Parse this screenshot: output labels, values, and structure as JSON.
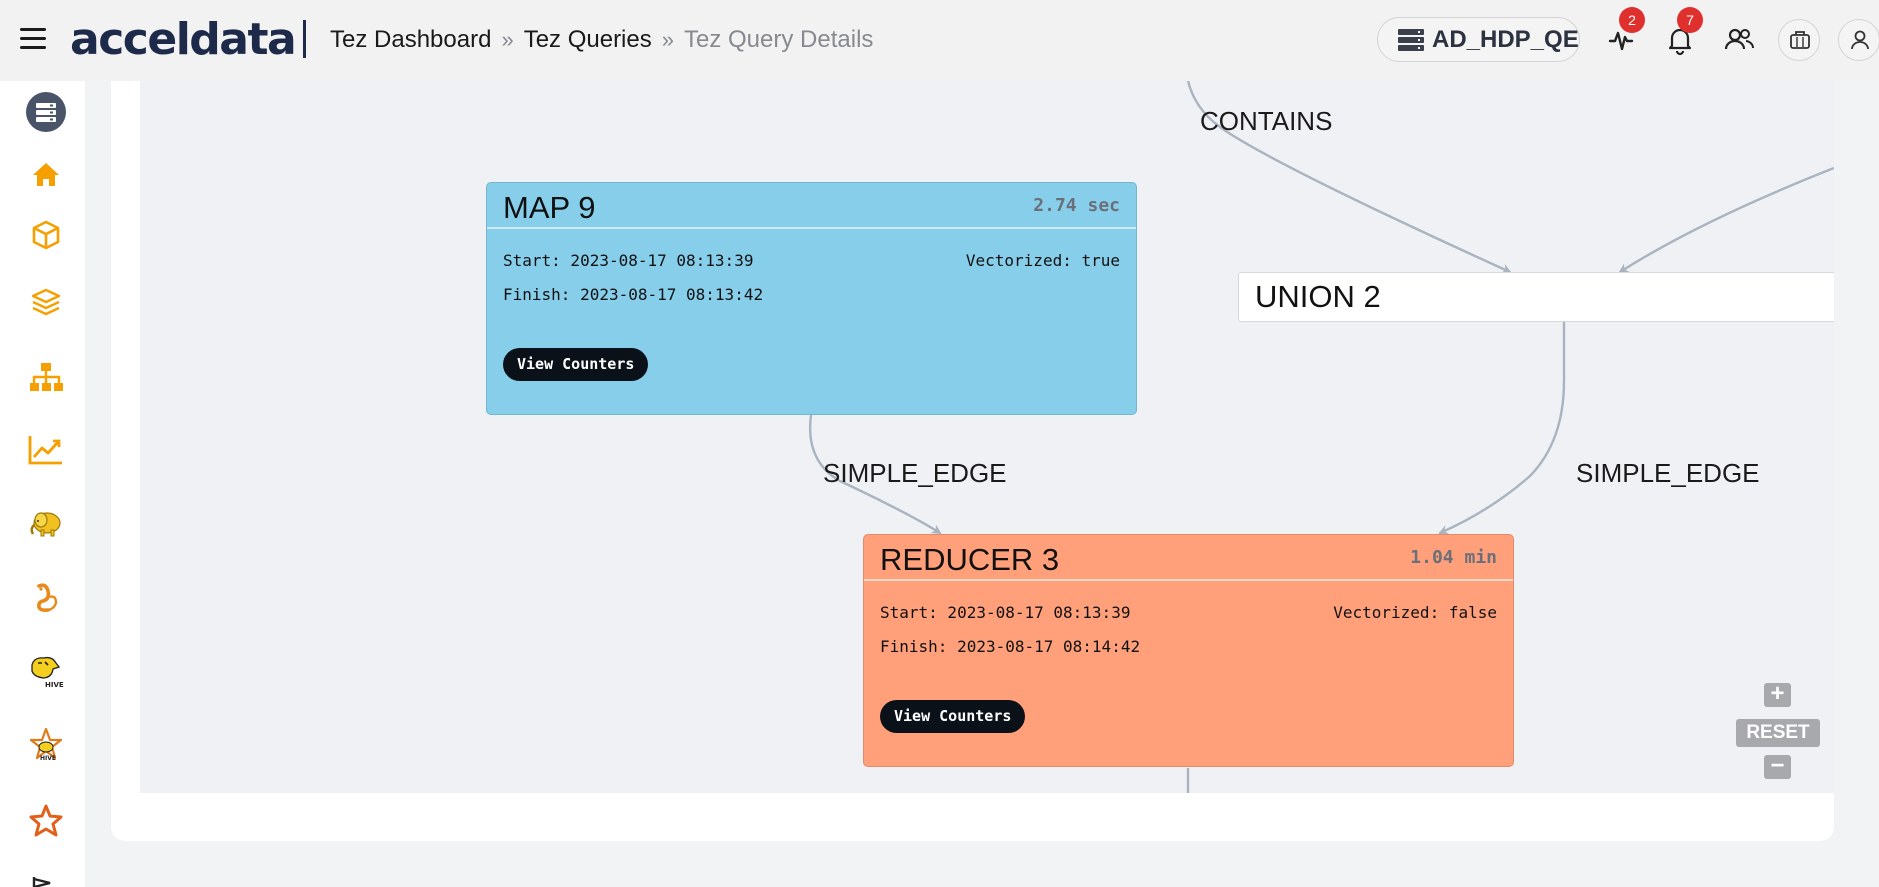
{
  "header": {
    "logo": "acceldata",
    "breadcrumbs": [
      "Tez Dashboard",
      "Tez Queries",
      "Tez Query Details"
    ],
    "breadcrumb_separator": "»",
    "cluster": "AD_HDP_QE",
    "alerts_badge": "2",
    "notifications_badge": "7",
    "icons": [
      "menu-icon",
      "database-icon",
      "pulse-icon",
      "bell-icon",
      "users-icon",
      "briefcase-icon",
      "user-icon"
    ]
  },
  "sidebar": {
    "icons": [
      "server-icon",
      "home-icon",
      "cube-icon",
      "layers-icon",
      "sitemap-icon",
      "chart-line-icon",
      "hadoop-elephant-icon",
      "squirrel-icon",
      "hive-icon",
      "star-hive-icon",
      "star-icon",
      "flag-icon"
    ]
  },
  "graph": {
    "edges": [
      "CONTAINS",
      "SIMPLE_EDGE",
      "SIMPLE_EDGE"
    ],
    "union_node": {
      "title": "UNION 2"
    },
    "map_node": {
      "title": "MAP 9",
      "duration": "2.74 sec",
      "start": "Start: 2023-08-17 08:13:39",
      "finish": "Finish: 2023-08-17 08:13:42",
      "vectorized": "Vectorized: true",
      "button": "View Counters",
      "color": "#87ceeb"
    },
    "reducer_node": {
      "title": "REDUCER 3",
      "duration": "1.04 min",
      "start": "Start: 2023-08-17 08:13:39",
      "finish": "Finish: 2023-08-17 08:14:42",
      "vectorized": "Vectorized: false",
      "button": "View Counters",
      "color": "#ffa07a"
    }
  },
  "zoom_controls": {
    "zoom_in": "+",
    "reset": "RESET",
    "zoom_out": "−"
  },
  "colors": {
    "accent": "#f5a000",
    "badge": "#e0302e",
    "brand": "#1e2a4a",
    "edge": "#a9b4c0"
  }
}
